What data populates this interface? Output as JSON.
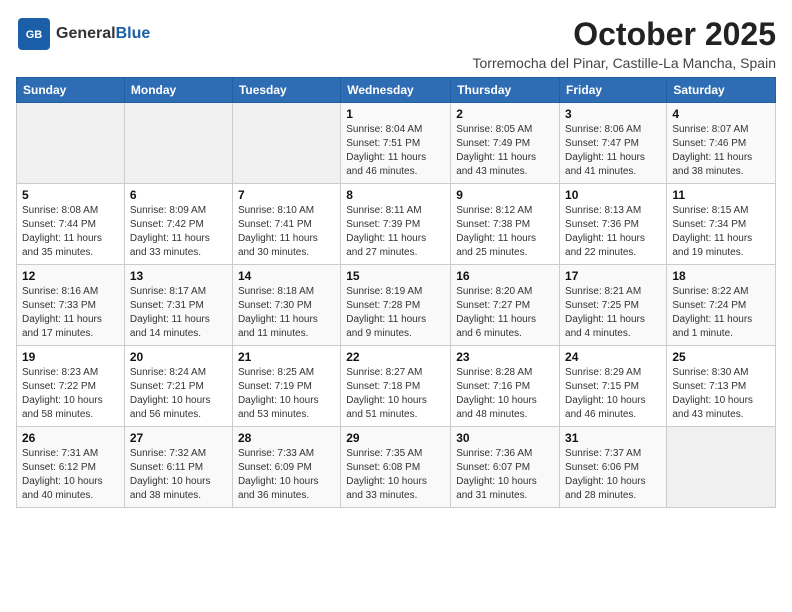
{
  "header": {
    "logo_line1": "General",
    "logo_line2": "Blue",
    "month": "October 2025",
    "location": "Torremocha del Pinar, Castille-La Mancha, Spain"
  },
  "days_of_week": [
    "Sunday",
    "Monday",
    "Tuesday",
    "Wednesday",
    "Thursday",
    "Friday",
    "Saturday"
  ],
  "weeks": [
    [
      {
        "num": "",
        "info": ""
      },
      {
        "num": "",
        "info": ""
      },
      {
        "num": "",
        "info": ""
      },
      {
        "num": "1",
        "info": "Sunrise: 8:04 AM\nSunset: 7:51 PM\nDaylight: 11 hours and 46 minutes."
      },
      {
        "num": "2",
        "info": "Sunrise: 8:05 AM\nSunset: 7:49 PM\nDaylight: 11 hours and 43 minutes."
      },
      {
        "num": "3",
        "info": "Sunrise: 8:06 AM\nSunset: 7:47 PM\nDaylight: 11 hours and 41 minutes."
      },
      {
        "num": "4",
        "info": "Sunrise: 8:07 AM\nSunset: 7:46 PM\nDaylight: 11 hours and 38 minutes."
      }
    ],
    [
      {
        "num": "5",
        "info": "Sunrise: 8:08 AM\nSunset: 7:44 PM\nDaylight: 11 hours and 35 minutes."
      },
      {
        "num": "6",
        "info": "Sunrise: 8:09 AM\nSunset: 7:42 PM\nDaylight: 11 hours and 33 minutes."
      },
      {
        "num": "7",
        "info": "Sunrise: 8:10 AM\nSunset: 7:41 PM\nDaylight: 11 hours and 30 minutes."
      },
      {
        "num": "8",
        "info": "Sunrise: 8:11 AM\nSunset: 7:39 PM\nDaylight: 11 hours and 27 minutes."
      },
      {
        "num": "9",
        "info": "Sunrise: 8:12 AM\nSunset: 7:38 PM\nDaylight: 11 hours and 25 minutes."
      },
      {
        "num": "10",
        "info": "Sunrise: 8:13 AM\nSunset: 7:36 PM\nDaylight: 11 hours and 22 minutes."
      },
      {
        "num": "11",
        "info": "Sunrise: 8:15 AM\nSunset: 7:34 PM\nDaylight: 11 hours and 19 minutes."
      }
    ],
    [
      {
        "num": "12",
        "info": "Sunrise: 8:16 AM\nSunset: 7:33 PM\nDaylight: 11 hours and 17 minutes."
      },
      {
        "num": "13",
        "info": "Sunrise: 8:17 AM\nSunset: 7:31 PM\nDaylight: 11 hours and 14 minutes."
      },
      {
        "num": "14",
        "info": "Sunrise: 8:18 AM\nSunset: 7:30 PM\nDaylight: 11 hours and 11 minutes."
      },
      {
        "num": "15",
        "info": "Sunrise: 8:19 AM\nSunset: 7:28 PM\nDaylight: 11 hours and 9 minutes."
      },
      {
        "num": "16",
        "info": "Sunrise: 8:20 AM\nSunset: 7:27 PM\nDaylight: 11 hours and 6 minutes."
      },
      {
        "num": "17",
        "info": "Sunrise: 8:21 AM\nSunset: 7:25 PM\nDaylight: 11 hours and 4 minutes."
      },
      {
        "num": "18",
        "info": "Sunrise: 8:22 AM\nSunset: 7:24 PM\nDaylight: 11 hours and 1 minute."
      }
    ],
    [
      {
        "num": "19",
        "info": "Sunrise: 8:23 AM\nSunset: 7:22 PM\nDaylight: 10 hours and 58 minutes."
      },
      {
        "num": "20",
        "info": "Sunrise: 8:24 AM\nSunset: 7:21 PM\nDaylight: 10 hours and 56 minutes."
      },
      {
        "num": "21",
        "info": "Sunrise: 8:25 AM\nSunset: 7:19 PM\nDaylight: 10 hours and 53 minutes."
      },
      {
        "num": "22",
        "info": "Sunrise: 8:27 AM\nSunset: 7:18 PM\nDaylight: 10 hours and 51 minutes."
      },
      {
        "num": "23",
        "info": "Sunrise: 8:28 AM\nSunset: 7:16 PM\nDaylight: 10 hours and 48 minutes."
      },
      {
        "num": "24",
        "info": "Sunrise: 8:29 AM\nSunset: 7:15 PM\nDaylight: 10 hours and 46 minutes."
      },
      {
        "num": "25",
        "info": "Sunrise: 8:30 AM\nSunset: 7:13 PM\nDaylight: 10 hours and 43 minutes."
      }
    ],
    [
      {
        "num": "26",
        "info": "Sunrise: 7:31 AM\nSunset: 6:12 PM\nDaylight: 10 hours and 40 minutes."
      },
      {
        "num": "27",
        "info": "Sunrise: 7:32 AM\nSunset: 6:11 PM\nDaylight: 10 hours and 38 minutes."
      },
      {
        "num": "28",
        "info": "Sunrise: 7:33 AM\nSunset: 6:09 PM\nDaylight: 10 hours and 36 minutes."
      },
      {
        "num": "29",
        "info": "Sunrise: 7:35 AM\nSunset: 6:08 PM\nDaylight: 10 hours and 33 minutes."
      },
      {
        "num": "30",
        "info": "Sunrise: 7:36 AM\nSunset: 6:07 PM\nDaylight: 10 hours and 31 minutes."
      },
      {
        "num": "31",
        "info": "Sunrise: 7:37 AM\nSunset: 6:06 PM\nDaylight: 10 hours and 28 minutes."
      },
      {
        "num": "",
        "info": ""
      }
    ]
  ]
}
